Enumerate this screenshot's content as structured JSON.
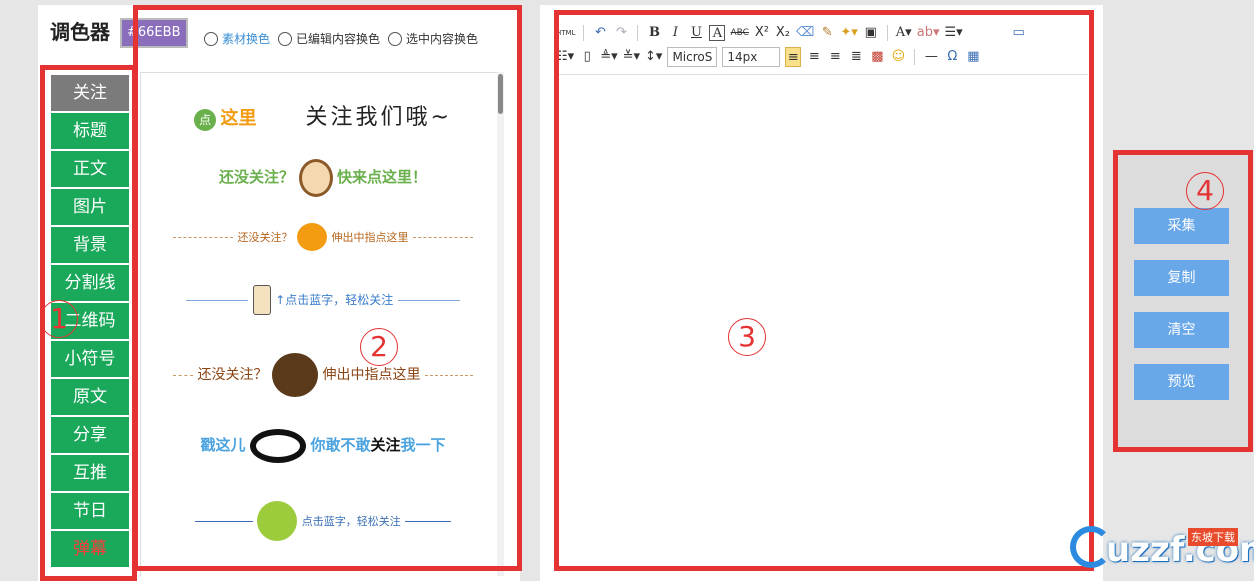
{
  "palette": {
    "title": "调色器",
    "color_value": "#66EBB",
    "radios": [
      "素材换色",
      "已编辑内容换色",
      "选中内容换色"
    ]
  },
  "categories": [
    "关注",
    "标题",
    "正文",
    "图片",
    "背景",
    "分割线",
    "二维码",
    "小符号",
    "原文",
    "分享",
    "互推",
    "节日",
    "弹幕"
  ],
  "templates": {
    "t1": {
      "tag": "点",
      "left": "这里",
      "right": "关注我们哦~"
    },
    "t2": {
      "left": "还没关注？",
      "right": "快来点这里！"
    },
    "t3": {
      "left": "还没关注？",
      "right": "伸出中指点这里"
    },
    "t4": {
      "text": "↑点击蓝字，轻松关注"
    },
    "t5": {
      "left": "还没关注？",
      "right": "伸出中指点这里"
    },
    "t6": {
      "left": "戳这儿",
      "right_a": "你敢不敢",
      "right_b": "关注",
      "right_c": "我一下"
    },
    "t7": {
      "text": "点击蓝字，轻松关注"
    }
  },
  "toolbar": {
    "html": "HTML",
    "font_family": "MicroS",
    "font_size": "14px"
  },
  "actions": [
    "采集",
    "复制",
    "清空",
    "预览"
  ],
  "annotations": [
    "1",
    "2",
    "3",
    "4"
  ],
  "watermark": {
    "brand": "uzzf.com",
    "badge": "东坡下载"
  },
  "colors": {
    "accent_green": "#1aa85a",
    "button_blue": "#68a7e8",
    "annotation_red": "#e53333"
  }
}
